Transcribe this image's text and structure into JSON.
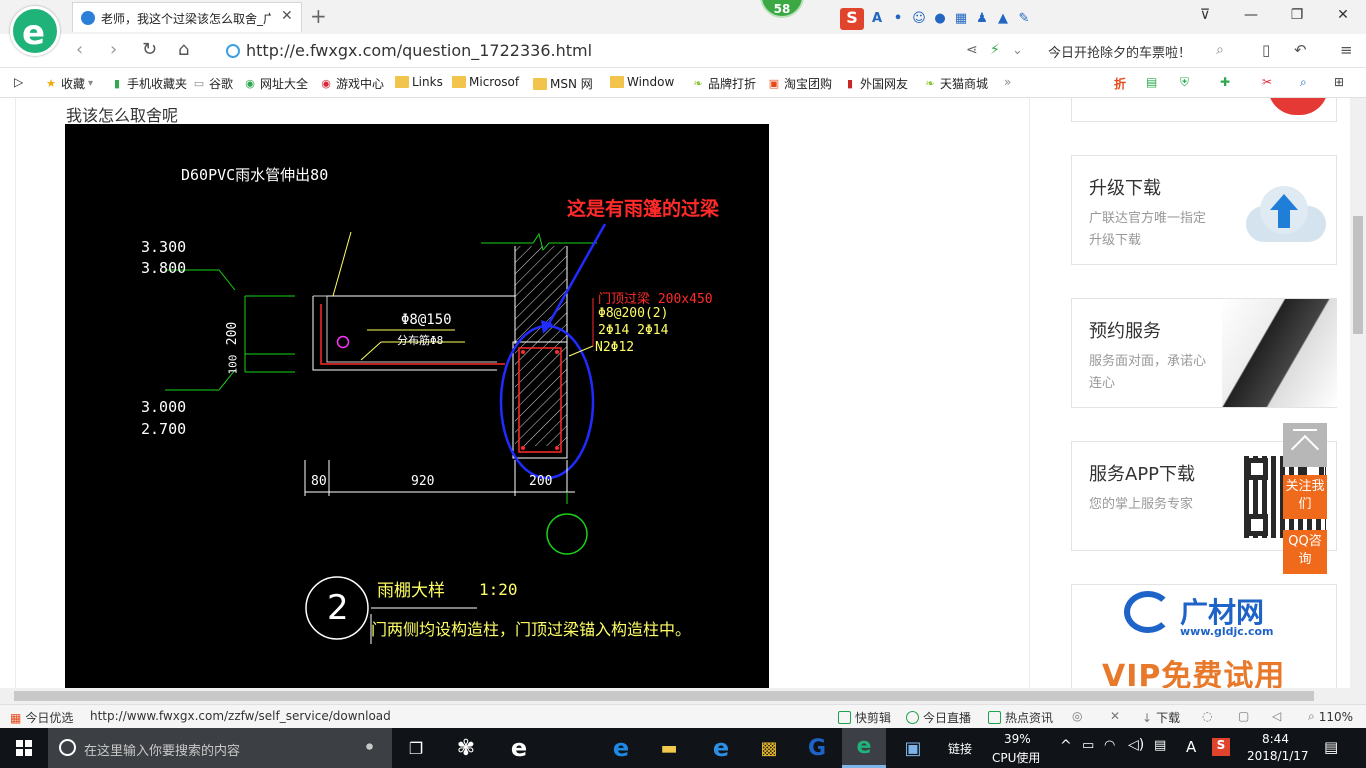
{
  "browser": {
    "tab_title": "老师，我这个过梁该怎么取舍_广",
    "badge_count": "58",
    "url": "http://e.fwxgx.com/question_1722336.html",
    "promo_text": "今日开抢除夕的车票啦！",
    "window_controls": [
      "restore",
      "minimize",
      "maximize",
      "close"
    ]
  },
  "bookmarks": [
    {
      "label": "收藏",
      "icon": "star-icon"
    },
    {
      "label": "手机收藏夹",
      "icon": "phone-icon"
    },
    {
      "label": "谷歌",
      "icon": "page-icon"
    },
    {
      "label": "网址大全",
      "icon": "globe-icon"
    },
    {
      "label": "游戏中心",
      "icon": "game-icon"
    },
    {
      "label": "Links",
      "icon": "folder-icon"
    },
    {
      "label": "Microsof",
      "icon": "folder-icon"
    },
    {
      "label": "MSN 网",
      "icon": "folder-icon"
    },
    {
      "label": "Window",
      "icon": "folder-icon"
    },
    {
      "label": "品牌打折",
      "icon": "leaf-icon"
    },
    {
      "label": "淘宝团购",
      "icon": "taobao-icon"
    },
    {
      "label": "外国网友",
      "icon": "flag-icon"
    },
    {
      "label": "天猫商城",
      "icon": "leaf-icon"
    }
  ],
  "page": {
    "question_text": "我该怎么取舍呢"
  },
  "drawing": {
    "pipe_note": "D60PVC雨水管伸出80",
    "annotation_red": "这是有雨篷的过梁",
    "elev_top1": "3.300",
    "elev_top2": "3.800",
    "elev_bot1": "3.000",
    "elev_bot2": "2.700",
    "dim_200_v": "200",
    "dim_100_v": "100",
    "rebar_a": "Φ8@150",
    "rebar_b": "分布筋Φ8",
    "beam_title": "门顶过梁 200x450",
    "beam_stirrup": "Φ8@200(2)",
    "beam_main": "2Φ14 2Φ14",
    "beam_side": "N2Φ12",
    "dim_80": "80",
    "dim_920": "920",
    "dim_200_h": "200",
    "detail_no": "2",
    "detail_title": "雨棚大样",
    "detail_scale": "1:20",
    "detail_note": "门两侧均设构造柱，门顶过梁锚入构造柱中。"
  },
  "sidebar": {
    "cards": [
      {
        "title": "升级下载",
        "subtitle": "广联达官方唯一指定升级下载",
        "icon": "upload-cloud-icon"
      },
      {
        "title": "预约服务",
        "subtitle": "服务面对面，承诺心连心",
        "icon": "handshake-image"
      },
      {
        "title": "服务APP下载",
        "subtitle": "您的掌上服务专家",
        "icon": "qr-code-icon"
      }
    ],
    "ad_brand": "广材网",
    "ad_url": "www.gldjc.com",
    "ad_vip": "VIP免费试用",
    "follow_label": "关注我们",
    "qq_label": "QQ咨询"
  },
  "statusbar": {
    "today_pick": "今日优选",
    "hover_url": "http://www.fwxgx.com/zzfw/self_service/download",
    "quick_clip": "快剪辑",
    "live": "今日直播",
    "hot_news": "热点资讯",
    "download": "下载",
    "zoom": "110%"
  },
  "taskbar": {
    "search_placeholder": "在这里输入你要搜索的内容",
    "link_label": "链接",
    "cpu_percent": "39%",
    "cpu_label": "CPU使用",
    "ime_letter": "A",
    "time": "8:44",
    "date": "2018/1/17"
  },
  "colors": {
    "cad_bg": "#000000",
    "cad_yellow": "#ffff66",
    "cad_green": "#19d219",
    "cad_red": "#ff2a2a",
    "cad_blue": "#1f2bff",
    "accent_orange": "#f06a1b",
    "browser_green": "#1fb37a"
  }
}
